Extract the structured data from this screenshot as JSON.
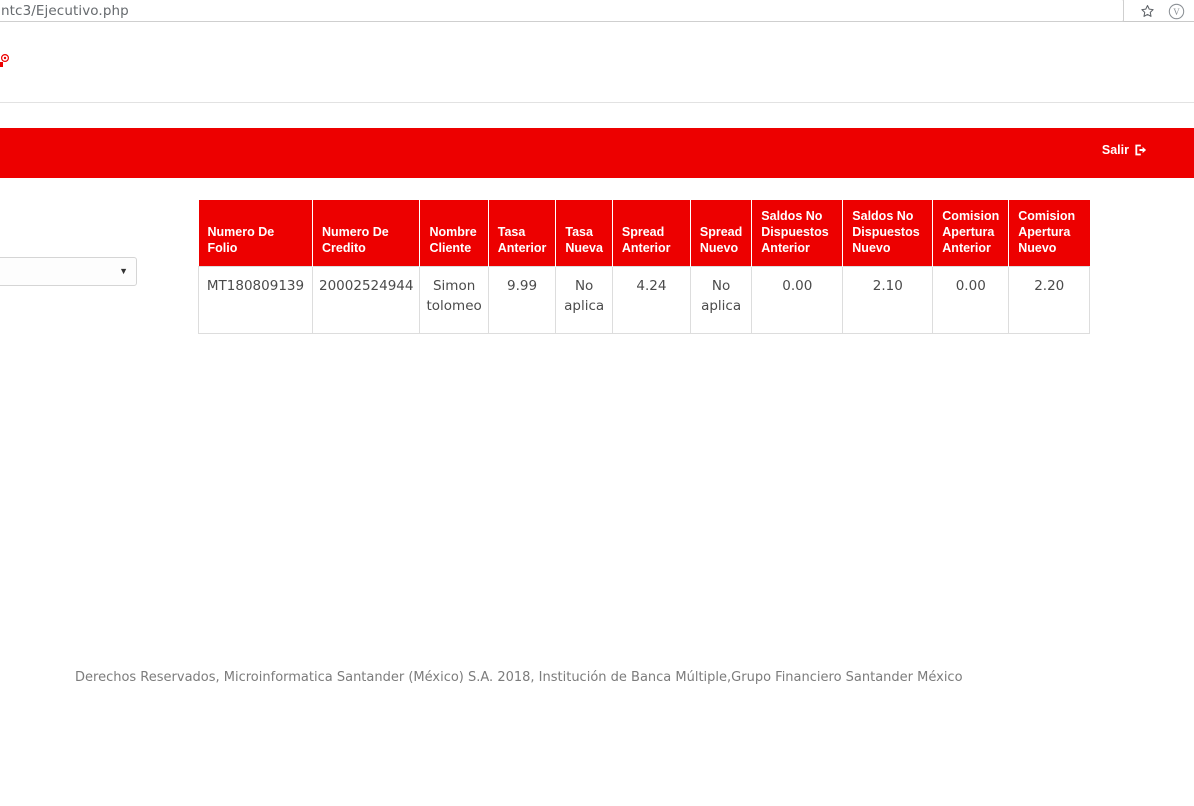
{
  "browser": {
    "url": "ntc3/Ejecutivo.php",
    "star_icon": "star-icon",
    "profile_icon": "profile-avatar-icon"
  },
  "header": {
    "logout_label": "Salir",
    "logout_icon": "sign-out-icon",
    "brand_color": "#ED0000"
  },
  "filter": {
    "selected_value": "",
    "caret_icon": "chevron-down-icon"
  },
  "table": {
    "columns": [
      "Numero De Folio",
      "Numero De Credito",
      "Nombre Cliente",
      "Tasa Anterior",
      "Tasa Nueva",
      "Spread Anterior",
      "Spread Nuevo",
      "Saldos No Dispuestos Anterior",
      "Saldos No Dispuestos Nuevo",
      "Comision Apertura Anterior",
      "Comision Apertura Nuevo"
    ],
    "rows": [
      [
        "MT180809139",
        "20002524944",
        "Simon tolomeo",
        "9.99",
        "No aplica",
        "4.24",
        "No aplica",
        "0.00",
        "2.10",
        "0.00",
        "2.20"
      ]
    ]
  },
  "footer": {
    "copyright": "Derechos Reservados, Microinformatica Santander (México) S.A. 2018, Institución de Banca Múltiple,Grupo Financiero Santander México"
  }
}
